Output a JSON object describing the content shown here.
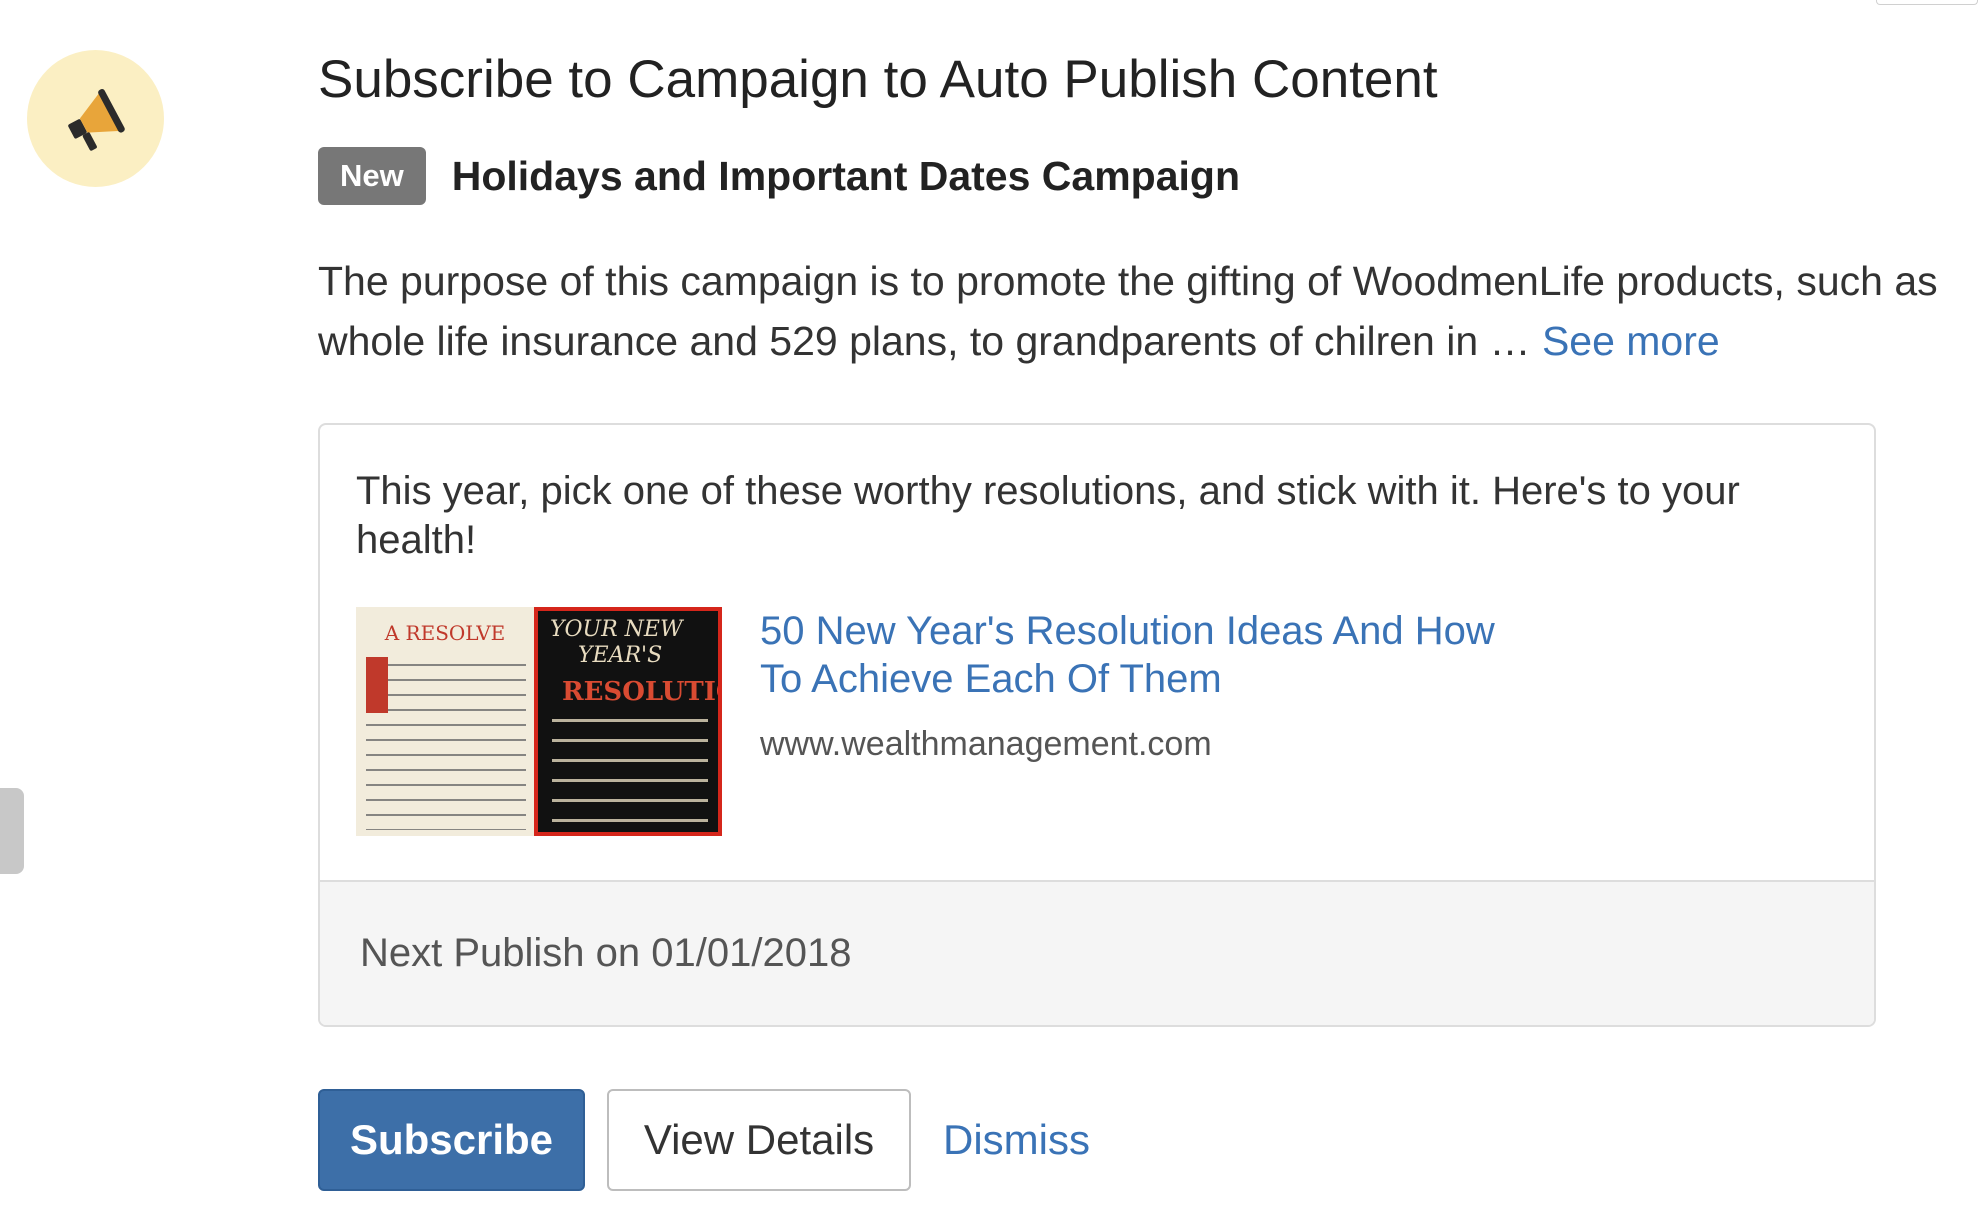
{
  "header": {
    "icon": "megaphone-icon",
    "title": "Subscribe to Campaign to Auto Publish Content"
  },
  "campaign": {
    "badge": "New",
    "name": "Holidays and Important Dates Campaign",
    "description": "The purpose of this campaign is to promote the gifting of WoodmenLife products, such as whole life insurance and 529 plans, to grandparents of chilren in …",
    "see_more_label": "See more"
  },
  "card": {
    "text": "This year, pick one of these worthy resolutions, and stick with it. Here's to your health!",
    "thumbnail": {
      "left_header": "A RESOLVE",
      "right_line1": "YOUR NEW",
      "right_line2": "YEAR'S",
      "right_line3": "RESOLUTION"
    },
    "link_title": "50 New Year's Resolution Ideas And How To Achieve Each Of Them",
    "link_domain": "www.wealthmanagement.com",
    "footer_text": "Next Publish on 01/01/2018"
  },
  "actions": {
    "subscribe_label": "Subscribe",
    "view_details_label": "View Details",
    "dismiss_label": "Dismiss"
  },
  "colors": {
    "link": "#3a73b6",
    "primary_button": "#3d6fa8",
    "badge": "#777777",
    "avatar_bg": "#fbefc3"
  }
}
